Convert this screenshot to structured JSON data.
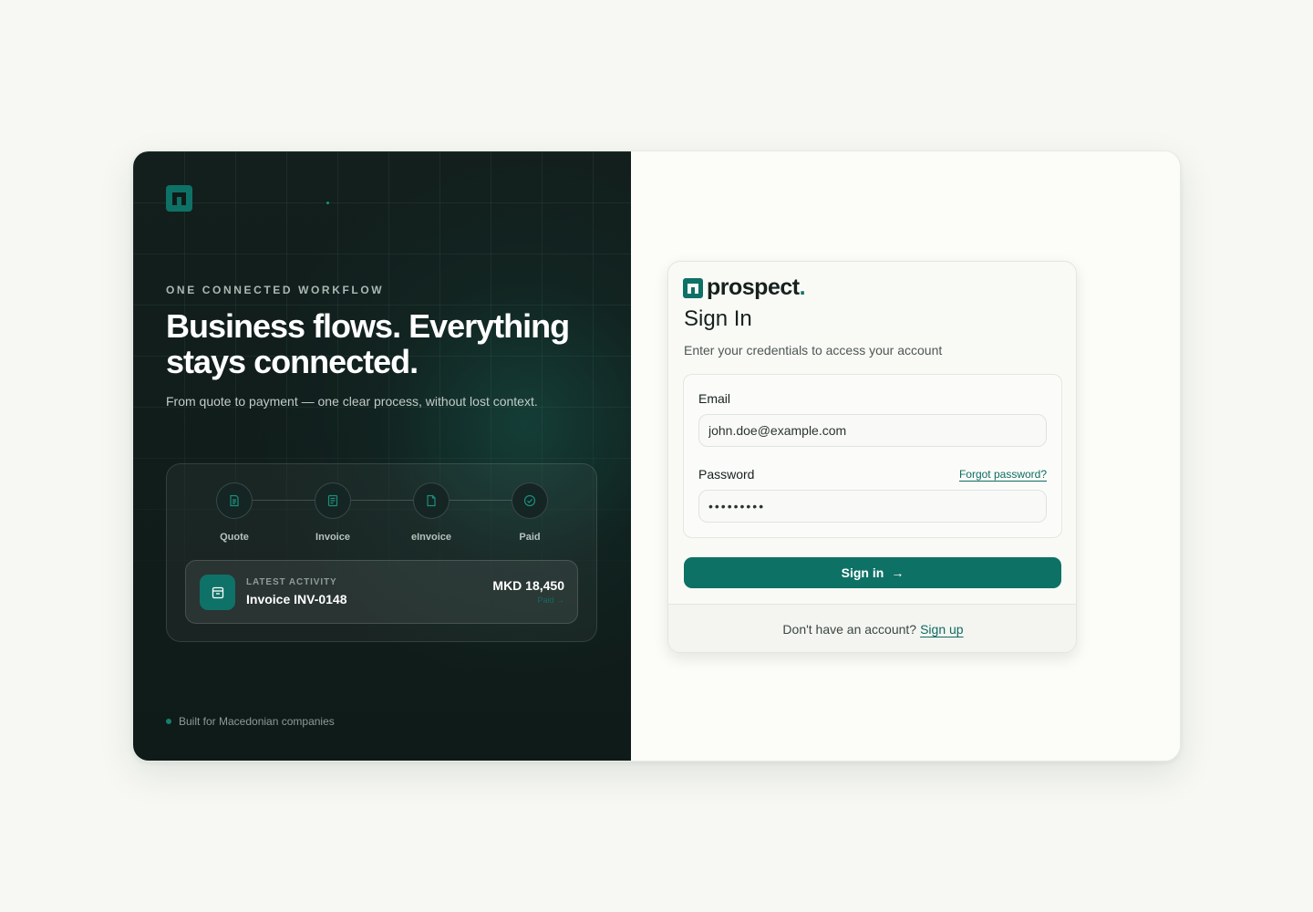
{
  "colors": {
    "page_bg": "#f7f8f4",
    "dark_panel": "#111e1c",
    "accent": "#0e7166",
    "link": "#0f6b62"
  },
  "left": {
    "logo_icon": "prospect-mark-icon",
    "eyebrow": "ONE CONNECTED WORKFLOW",
    "headline": "Business flows. Everything stays connected.",
    "subcopy": "From quote to payment — one clear process, without lost context.",
    "steps": [
      {
        "label": "Quote",
        "icon": "document-icon"
      },
      {
        "label": "Invoice",
        "icon": "invoice-icon"
      },
      {
        "label": "eInvoice",
        "icon": "file-icon"
      },
      {
        "label": "Paid",
        "icon": "check-circle-icon"
      }
    ],
    "activity": {
      "icon": "inbox-icon",
      "eyebrow": "LATEST ACTIVITY",
      "title": "Invoice INV-0148",
      "amount": "MKD 18,450",
      "status": "Paid →"
    },
    "footnote": "Built for Macedonian companies"
  },
  "signin": {
    "brand_name": "prospect",
    "brand_dot": ".",
    "title": "Sign In",
    "subtitle": "Enter your credentials to access your account",
    "email_label": "Email",
    "email_value": "john.doe@example.com",
    "password_label": "Password",
    "password_value": "password1",
    "forgot_label": "Forgot password?",
    "submit_label": "Sign in",
    "submit_icon": "arrow-right-icon",
    "footer_text": "Don't have an account?",
    "signup_label": "Sign up"
  }
}
